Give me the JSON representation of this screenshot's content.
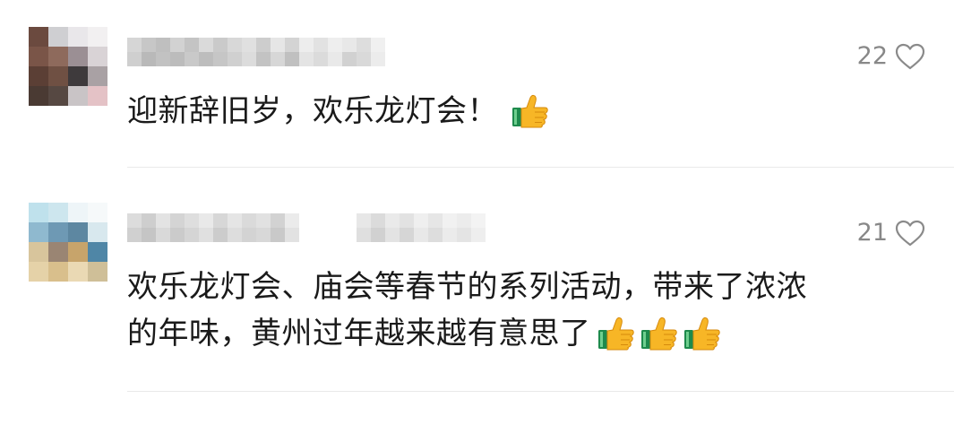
{
  "comments": [
    {
      "like_count": "22",
      "text": "迎新辞旧岁，欢乐龙灯会！",
      "emoji": [
        "thumbs-up"
      ]
    },
    {
      "like_count": "21",
      "text_line1": "欢乐龙灯会、庙会等春节的系列活动，带来了浓浓",
      "text_line2": "的年味，黄州过年越来越有意思了",
      "emoji": [
        "thumbs-up",
        "thumbs-up",
        "thumbs-up"
      ]
    }
  ],
  "colors": {
    "text": "#1a1a1a",
    "meta": "#888888",
    "divider": "#e9e9e9",
    "thumb_yellow": "#f7b626",
    "thumb_cuff": "#1e8a4c"
  }
}
